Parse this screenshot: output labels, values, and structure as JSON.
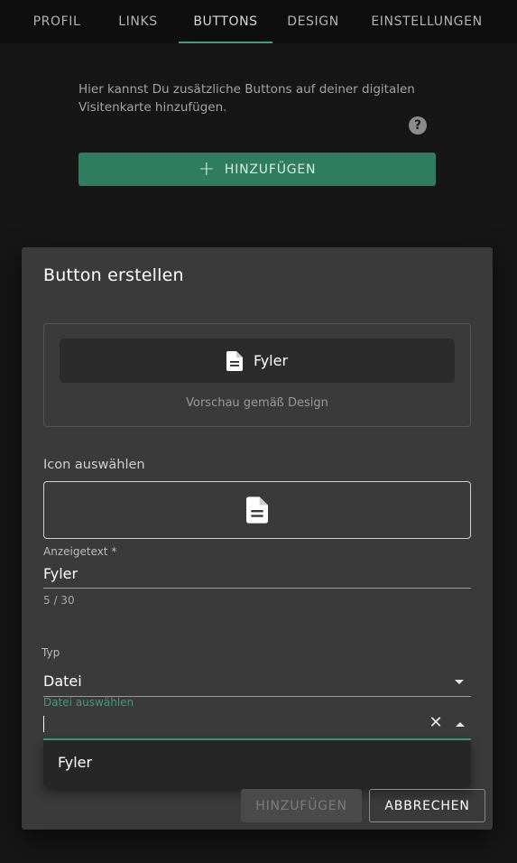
{
  "tabs": [
    {
      "label": "PROFIL"
    },
    {
      "label": "LINKS"
    },
    {
      "label": "BUTTONS"
    },
    {
      "label": "DESIGN"
    },
    {
      "label": "EINSTELLUNGEN"
    }
  ],
  "active_tab": "BUTTONS",
  "intro": {
    "text": "Hier kannst Du zusätzliche Buttons auf deiner digitalen Visitenkarte hinzufügen.",
    "help_glyph": "?",
    "add_label": "HINZUFÜGEN",
    "add_icon": "plus-icon"
  },
  "dialog": {
    "title": "Button erstellen",
    "preview": {
      "button_label": "Fyler",
      "button_icon": "document-icon",
      "caption": "Vorschau gemäß Design"
    },
    "icon_section_label": "Icon auswählen",
    "selected_icon": "document-icon",
    "display_text": {
      "label": "Anzeigetext *",
      "value": "Fyler",
      "counter": "5 / 30"
    },
    "type": {
      "label": "Typ",
      "value": "Datei"
    },
    "file": {
      "label": "Datei auswählen",
      "value": "",
      "options": [
        "Fyler"
      ]
    },
    "buttons": {
      "add_label": "HINZUFÜGEN",
      "cancel_label": "ABBRECHEN"
    }
  },
  "colors": {
    "accent": "#3f9c7d",
    "primary_button": "#2f7d60",
    "dialog_bg": "#3a3a3a",
    "tab_bar_bg": "#0e0e0e"
  }
}
